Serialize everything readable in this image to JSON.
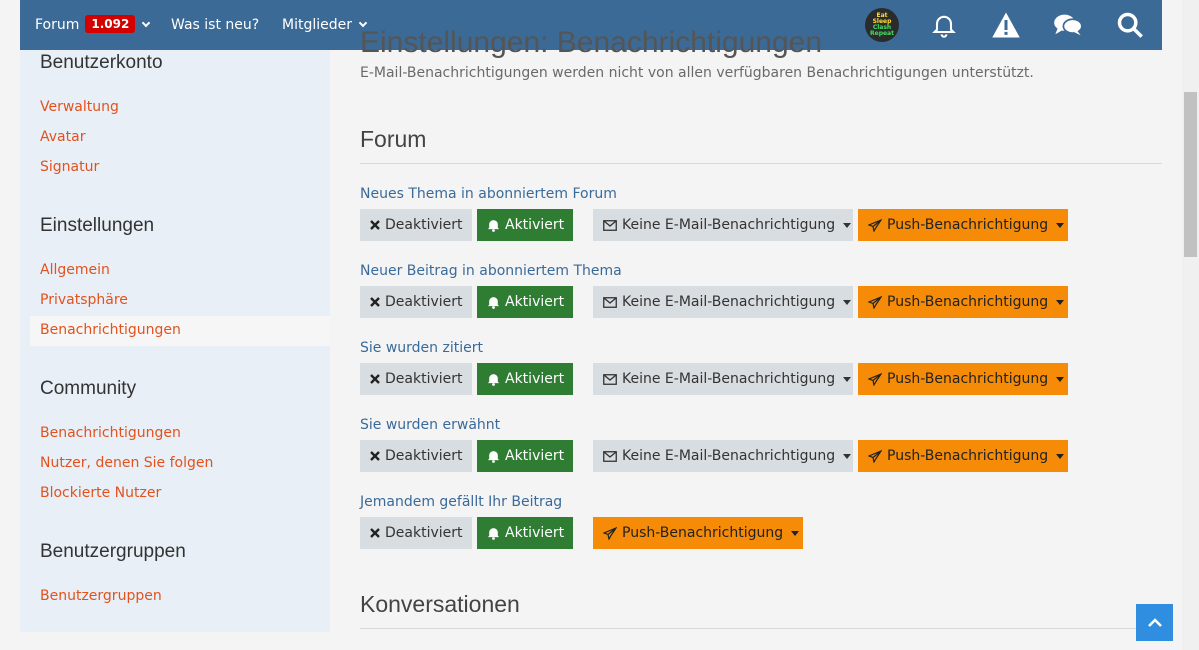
{
  "nav": {
    "forum_label": "Forum",
    "forum_badge": "1.092",
    "whats_new_label": "Was ist neu?",
    "members_label": "Mitglieder",
    "avatar_lines": [
      "Eat",
      "Sleep",
      "Clash",
      "Repeat"
    ]
  },
  "page": {
    "title": "Einstellungen: Benachrichtigungen",
    "description": "E-Mail-Benachrichtigungen werden nicht von allen verfügbaren Benachrichtigungen unterstützt."
  },
  "sidebar": {
    "groups": [
      {
        "heading": "Benutzerkonto",
        "items": [
          "Verwaltung",
          "Avatar",
          "Signatur"
        ]
      },
      {
        "heading": "Einstellungen",
        "items": [
          "Allgemein",
          "Privatsphäre",
          "Benachrichtigungen"
        ]
      },
      {
        "heading": "Community",
        "items": [
          "Benachrichtigungen",
          "Nutzer, denen Sie folgen",
          "Blockierte Nutzer"
        ]
      },
      {
        "heading": "Benutzergruppen",
        "items": [
          "Benutzergruppen"
        ]
      }
    ],
    "active_item": "Benachrichtigungen"
  },
  "buttons": {
    "deactivated": "Deaktiviert",
    "activated": "Aktiviert",
    "no_email": "Keine E-Mail-Benachrichtigung",
    "push": "Push-Benachrichtigung"
  },
  "sections": [
    {
      "title": "Forum",
      "rows": [
        "Neues Thema in abonniertem Forum",
        "Neuer Beitrag in abonniertem Thema",
        "Sie wurden zitiert",
        "Sie wurden erwähnt",
        "Jemandem gefällt Ihr Beitrag"
      ]
    },
    {
      "title": "Konversationen",
      "rows": []
    }
  ],
  "colors": {
    "nav_bg": "#3b6a96",
    "badge": "#d40000",
    "link": "#e2521e",
    "activated": "#2e7d32",
    "push": "#f58b07",
    "sidebar_bg": "#e8eff6"
  }
}
